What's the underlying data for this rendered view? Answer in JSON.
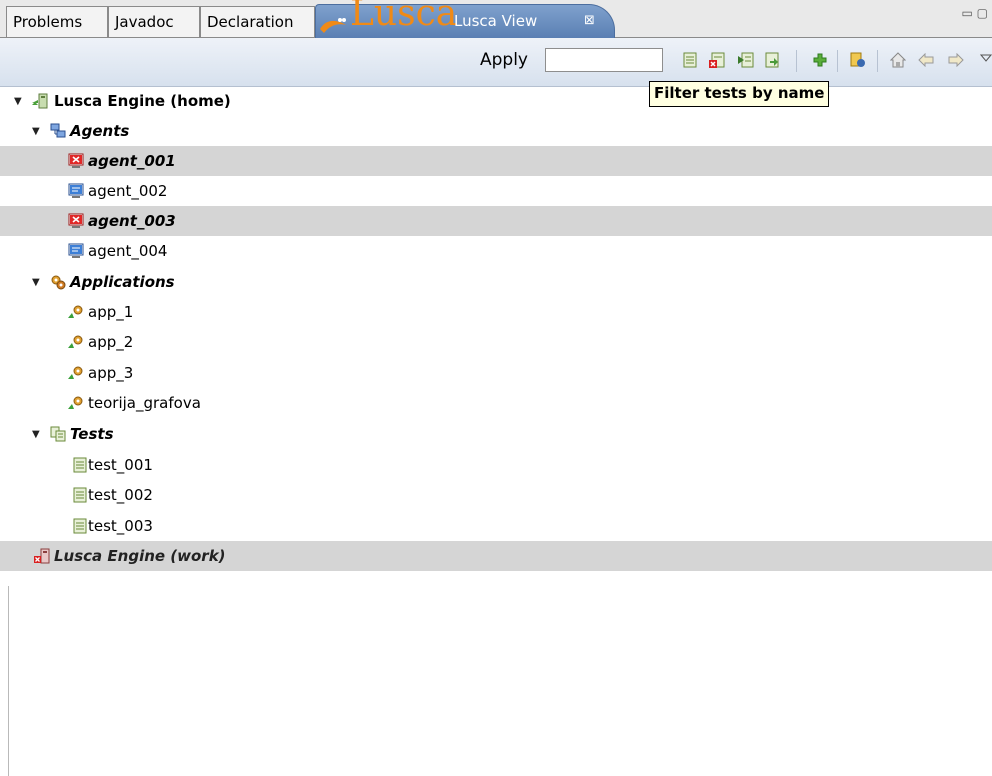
{
  "tabs": [
    {
      "label": "Problems"
    },
    {
      "label": "Javadoc"
    },
    {
      "label": "Declaration"
    }
  ],
  "active_tab": {
    "logo_text": "Lusca",
    "label": "Lusca View",
    "close_glyph": "⊠"
  },
  "window_controls": "▭ ▢",
  "toolbar": {
    "apply_label": "Apply",
    "filter_value": "",
    "filter_placeholder": "",
    "buttons": [
      "test-file-icon",
      "remove-test-icon",
      "run-test-icon",
      "export-test-icon",
      "add-icon",
      "properties-icon",
      "home-icon",
      "back-icon",
      "forward-icon",
      "view-menu-icon"
    ]
  },
  "tooltip": "Filter tests by name",
  "tree": {
    "home_engine": "Lusca Engine (home)",
    "agents_label": "Agents",
    "agents": [
      {
        "label": "agent_001",
        "status": "error"
      },
      {
        "label": "agent_002",
        "status": "ok"
      },
      {
        "label": "agent_003",
        "status": "error"
      },
      {
        "label": "agent_004",
        "status": "ok"
      }
    ],
    "applications_label": "Applications",
    "applications": [
      "app_1",
      "app_2",
      "app_3",
      "teorija_grafova"
    ],
    "tests_label": "Tests",
    "tests": [
      "test_001",
      "test_002",
      "test_003"
    ],
    "work_engine": "Lusca Engine (work)"
  },
  "colors": {
    "accent_tab": "#6f93c4",
    "selection": "#d5d5d5",
    "tooltip_bg": "#ffffe1",
    "logo": "#f08a16"
  }
}
